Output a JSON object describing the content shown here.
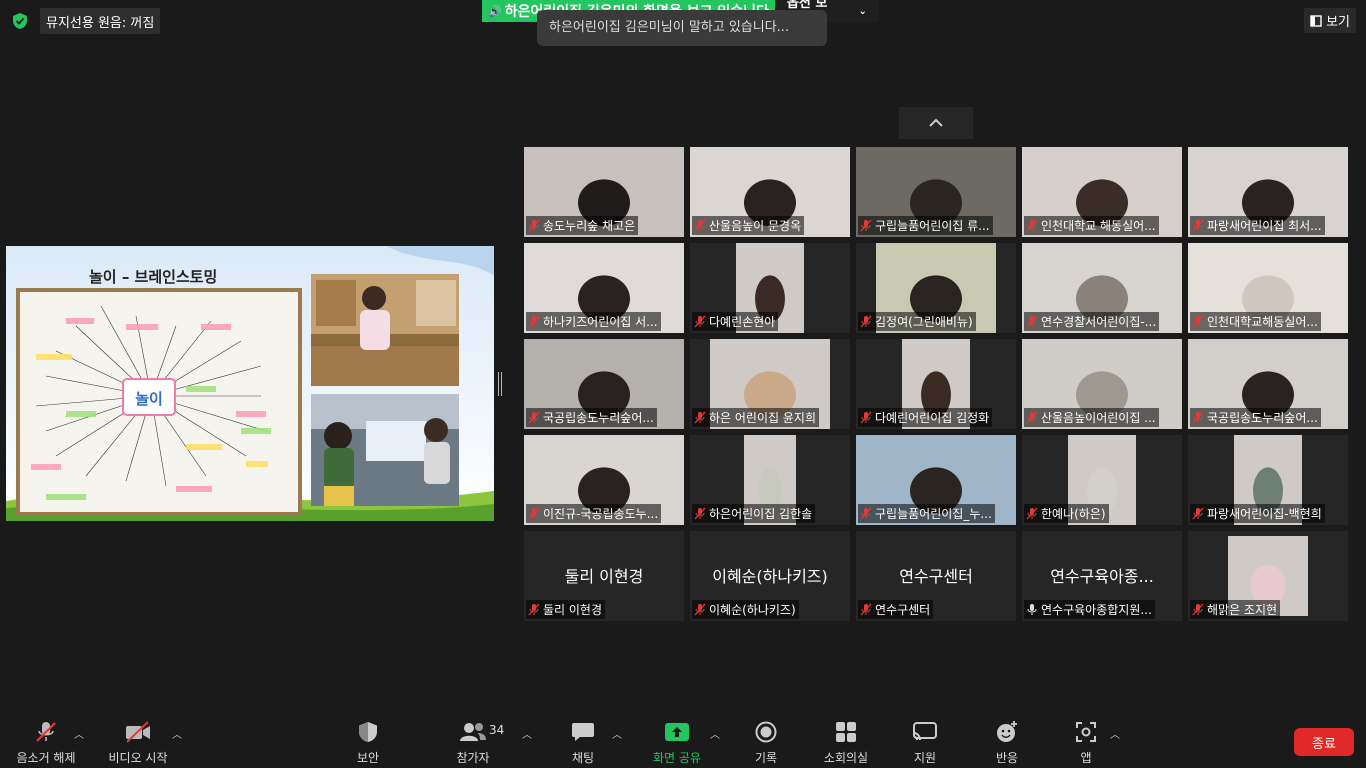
{
  "top": {
    "audio_badge": "뮤지선용 원음: 꺼짐",
    "share_banner": "하은어린이집 김은미의 화면을 보고 있습니다",
    "options_label": "옵션 보기",
    "speaking_tip": "하은어린이집 김은미님이 말하고 있습니다...",
    "view_label": "보기"
  },
  "shared_screen": {
    "slide_title": "놀이 – 브레인스토밍",
    "center_word": "놀이"
  },
  "participants": [
    {
      "label": "송도누리숲 채고은"
    },
    {
      "label": "산울음높이 문경옥"
    },
    {
      "label": "구립늘품어린이집 류..."
    },
    {
      "label": "인천대학교 해동실어..."
    },
    {
      "label": "파랑새어린이집  최서..."
    },
    {
      "label": "하나키즈어린이집 서..."
    },
    {
      "label": "다예린손현아"
    },
    {
      "label": "김정여(그린애비뉴)"
    },
    {
      "label": "연수경찰서어린이집-..."
    },
    {
      "label": "인천대학교해동실어..."
    },
    {
      "label": "국공립송도누리숲어..."
    },
    {
      "label": "하은 어린이집 윤지희"
    },
    {
      "label": "다예린어린이집 김정화"
    },
    {
      "label": "산울음높이어린이집 ..."
    },
    {
      "label": "국공립송도누리숲어..."
    },
    {
      "label": "이진규-국공립송도누..."
    },
    {
      "label": "하은어린이집 김한솔"
    },
    {
      "label": "구립늘품어린이집_누..."
    },
    {
      "label": "한예나(하은)"
    },
    {
      "label": "파랑새어린이집-백현희"
    },
    {
      "label": "둘리 이현경",
      "big": "둘리 이현경"
    },
    {
      "label": "이혜순(하나키즈)",
      "big": "이혜순(하나키즈)"
    },
    {
      "label": "연수구센터",
      "big": "연수구센터"
    },
    {
      "label": "연수구육아종합지원...",
      "big": "연수구육아종...",
      "audio_on": true
    },
    {
      "label": "해맑은 조지현"
    }
  ],
  "toolbar": {
    "mute": "음소거 해제",
    "video": "비디오 시작",
    "security": "보안",
    "participants": "참가자",
    "participants_count": "34",
    "chat": "채팅",
    "share": "화면 공유",
    "record": "기록",
    "breakout": "소회의실",
    "support": "지원",
    "reactions": "반응",
    "apps": "앱",
    "end": "종료"
  },
  "colors": {
    "accent_green": "#22c55e",
    "end_red": "#e02828"
  }
}
